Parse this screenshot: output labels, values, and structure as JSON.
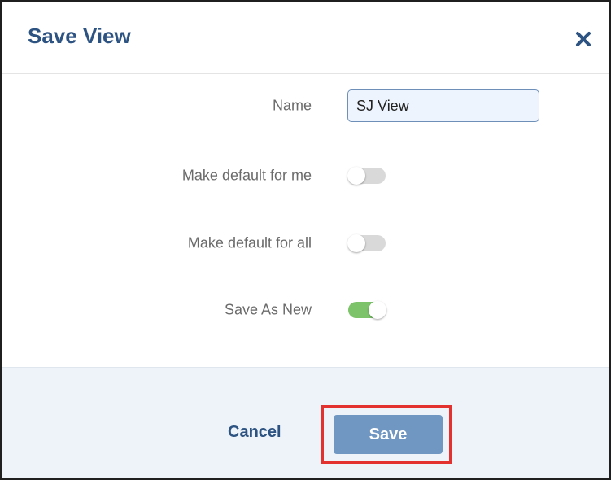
{
  "dialog": {
    "title": "Save View",
    "close_icon": "close-icon"
  },
  "form": {
    "name_label": "Name",
    "name_value": "SJ View",
    "default_me_label": "Make default for me",
    "default_me_on": false,
    "default_all_label": "Make default for all",
    "default_all_on": false,
    "save_as_new_label": "Save As New",
    "save_as_new_on": true
  },
  "footer": {
    "cancel_label": "Cancel",
    "save_label": "Save"
  },
  "colors": {
    "title": "#2d5382",
    "toggle_on": "#7cc36a",
    "toggle_off": "#d9d9d9",
    "save_button": "#7096c2",
    "footer_bg": "#eef3f9",
    "highlight": "#e3312f"
  }
}
